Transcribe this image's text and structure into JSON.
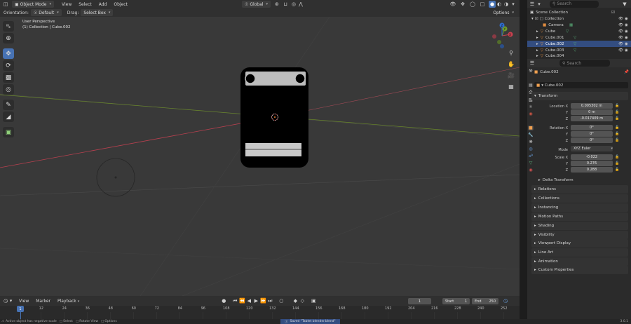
{
  "viewport": {
    "mode": "Object Mode",
    "menus": [
      "View",
      "Select",
      "Add",
      "Object"
    ],
    "transform_orientation": "Global",
    "orientation_label": "Orientation:",
    "orientation_value": "Default",
    "drag_label": "Drag:",
    "drag_value": "Select Box",
    "options": "Options",
    "overlay_title": "User Perspective",
    "overlay_subtitle": "(1) Collection | Cube.002",
    "gizmo": {
      "x": "X",
      "y": "Y",
      "z": "Z"
    }
  },
  "outliner": {
    "search_placeholder": "Search",
    "scene_collection": "Scene Collection",
    "items": [
      {
        "label": "Collection",
        "indent": 1
      },
      {
        "label": "Camera",
        "indent": 2
      },
      {
        "label": "Cube",
        "indent": 2
      },
      {
        "label": "Cube.001",
        "indent": 2
      },
      {
        "label": "Cube.002",
        "indent": 2
      },
      {
        "label": "Cube.003",
        "indent": 2
      },
      {
        "label": "Cube.004",
        "indent": 2
      }
    ]
  },
  "properties": {
    "search_placeholder": "Search",
    "object_name": "Cube.002",
    "object_name_field": "Cube.002",
    "transform": {
      "title": "Transform",
      "location_label": "Location X",
      "location": [
        "0.005302 m",
        "0 m",
        "-0.017409 m"
      ],
      "rotation_label": "Rotation X",
      "rotation": [
        "0°",
        "0°",
        "0°"
      ],
      "mode_label": "Mode",
      "mode_value": "XYZ Euler",
      "scale_label": "Scale X",
      "scale": [
        "-0.022",
        "0.276",
        "0.288"
      ],
      "y": "Y",
      "z": "Z",
      "delta": "Delta Transform"
    },
    "panels": [
      "Relations",
      "Collections",
      "Instancing",
      "Motion Paths",
      "Shading",
      "Visibility",
      "Viewport Display",
      "Line Art",
      "Animation",
      "Custom Properties"
    ]
  },
  "timeline": {
    "menus": [
      "View",
      "Marker",
      "Playback"
    ],
    "current_frame": "1",
    "start_label": "Start",
    "start_value": "1",
    "end_label": "End",
    "end_value": "250",
    "ticks": [
      "1",
      "12",
      "24",
      "36",
      "48",
      "60",
      "72",
      "84",
      "96",
      "108",
      "120",
      "132",
      "144",
      "156",
      "168",
      "180",
      "192",
      "204",
      "216",
      "228",
      "240",
      "252"
    ]
  },
  "statusbar": {
    "warning": "Active object has negative scale",
    "select": "Select",
    "rotate": "Rotate View",
    "options": "Options",
    "saved": "Saved \"Tablet blender.blend\"",
    "version": "3.0.1"
  },
  "colors": {
    "accent": "#4772b3",
    "x_axis": "#c8404f",
    "y_axis": "#6f9d2b",
    "z_axis": "#2f6dd0"
  }
}
